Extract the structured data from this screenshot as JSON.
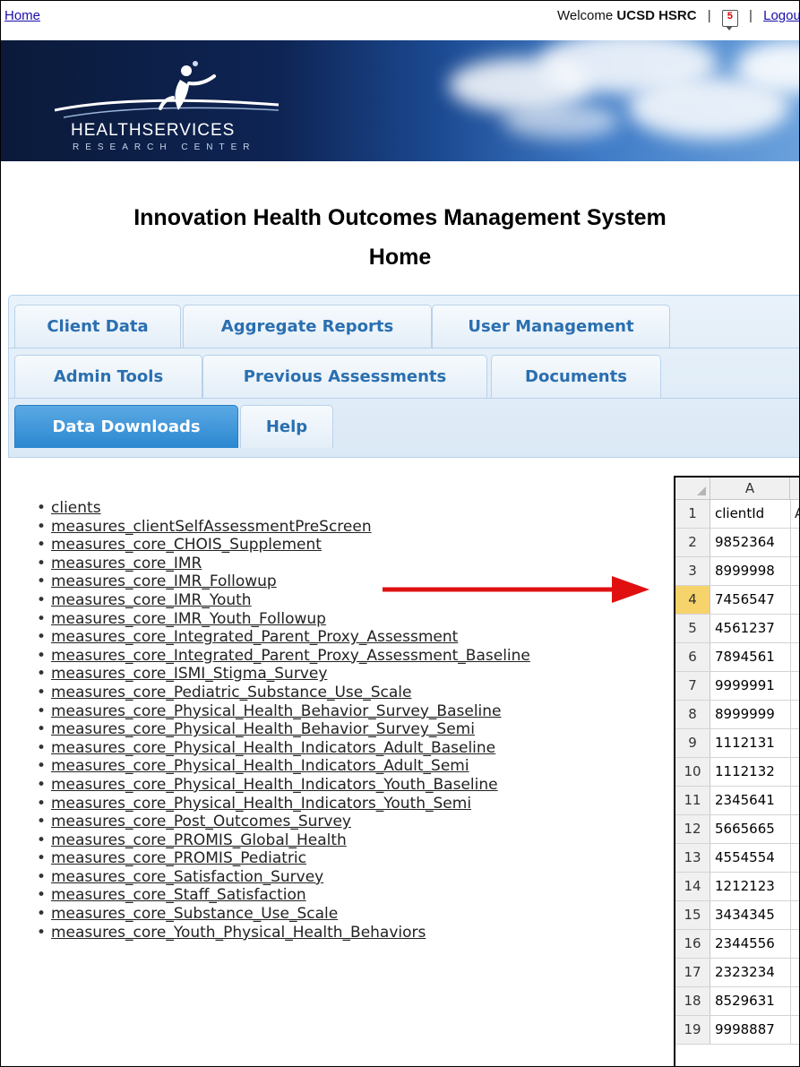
{
  "topbar": {
    "home_link": "Home",
    "welcome_prefix": "Welcome",
    "user_name": "UCSD HSRC",
    "separator": "|",
    "message_count": "5",
    "logout_link": "Logout"
  },
  "banner": {
    "logo_text": "HEALTHSERVICES",
    "logo_subtext": "RESEARCH CENTER"
  },
  "page": {
    "title_line1": "Innovation Health Outcomes Management System",
    "title_line2": "Home"
  },
  "tabs": [
    {
      "label": "Client Data"
    },
    {
      "label": "Aggregate Reports"
    },
    {
      "label": "User Management"
    },
    {
      "label": "Admin Tools"
    },
    {
      "label": "Previous Assessments"
    },
    {
      "label": "Documents"
    },
    {
      "label": "Data Downloads",
      "active": true
    },
    {
      "label": "Help"
    }
  ],
  "downloads": [
    "clients",
    "measures_clientSelfAssessmentPreScreen",
    "measures_core_CHOIS_Supplement",
    "measures_core_IMR",
    "measures_core_IMR_Followup",
    "measures_core_IMR_Youth",
    "measures_core_IMR_Youth_Followup",
    "measures_core_Integrated_Parent_Proxy_Assessment",
    "measures_core_Integrated_Parent_Proxy_Assessment_Baseline",
    "measures_core_ISMI_Stigma_Survey",
    "measures_core_Pediatric_Substance_Use_Scale",
    "measures_core_Physical_Health_Behavior_Survey_Baseline",
    "measures_core_Physical_Health_Behavior_Survey_Semi",
    "measures_core_Physical_Health_Indicators_Adult_Baseline",
    "measures_core_Physical_Health_Indicators_Adult_Semi",
    "measures_core_Physical_Health_Indicators_Youth_Baseline",
    "measures_core_Physical_Health_Indicators_Youth_Semi",
    "measures_core_Post_Outcomes_Survey",
    "measures_core_PROMIS_Global_Health",
    "measures_core_PROMIS_Pediatric",
    "measures_core_Satisfaction_Survey",
    "measures_core_Staff_Satisfaction",
    "measures_core_Substance_Use_Scale",
    "measures_core_Youth_Physical_Health_Behaviors"
  ],
  "spreadsheet": {
    "column_a": "A",
    "rows": [
      {
        "num": "1",
        "value": "clientId",
        "colB": "A"
      },
      {
        "num": "2",
        "value": "9852364"
      },
      {
        "num": "3",
        "value": "8999998"
      },
      {
        "num": "4",
        "value": "7456547",
        "selected": true
      },
      {
        "num": "5",
        "value": "4561237"
      },
      {
        "num": "6",
        "value": "7894561"
      },
      {
        "num": "7",
        "value": "9999991"
      },
      {
        "num": "8",
        "value": "8999999"
      },
      {
        "num": "9",
        "value": "1112131"
      },
      {
        "num": "10",
        "value": "1112132"
      },
      {
        "num": "11",
        "value": "2345641"
      },
      {
        "num": "12",
        "value": "5665665"
      },
      {
        "num": "13",
        "value": "4554554"
      },
      {
        "num": "14",
        "value": "1212123"
      },
      {
        "num": "15",
        "value": "3434345"
      },
      {
        "num": "16",
        "value": "2344556"
      },
      {
        "num": "17",
        "value": "2323234"
      },
      {
        "num": "18",
        "value": "8529631"
      },
      {
        "num": "19",
        "value": "9998887"
      }
    ]
  },
  "colors": {
    "tab_active": "#2c87d0",
    "tab_text": "#2a6fb0",
    "arrow": "#e01010",
    "row_highlight": "#f6d36b"
  }
}
